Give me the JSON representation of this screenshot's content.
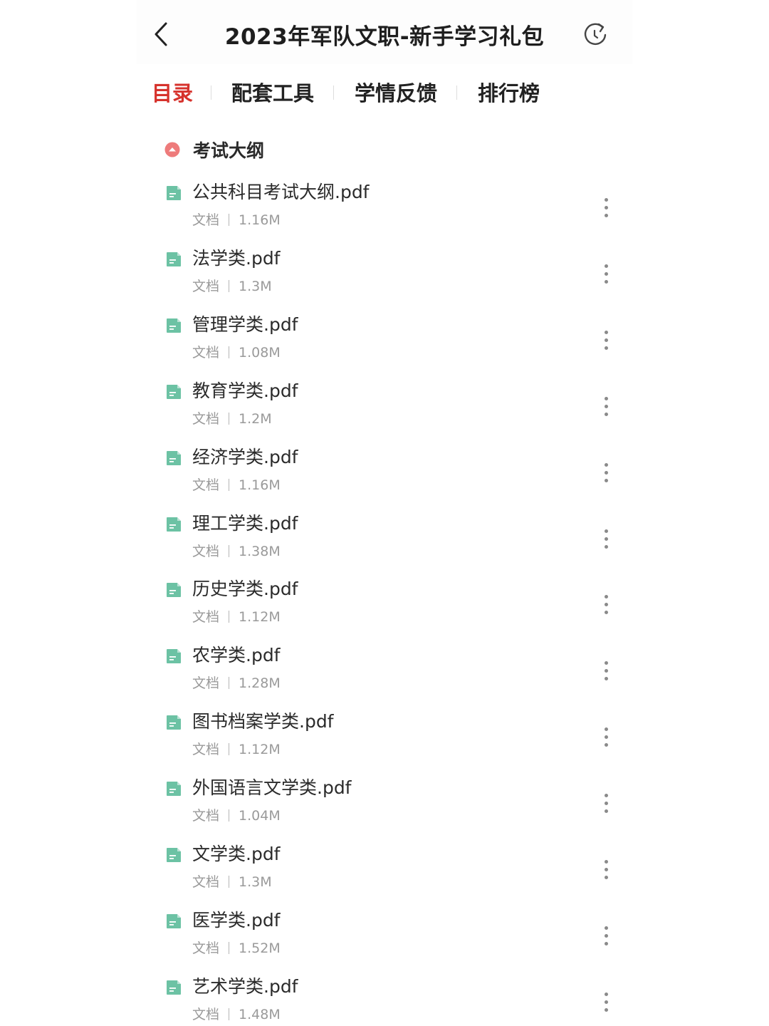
{
  "header": {
    "title": "2023年军队文职-新手学习礼包",
    "back_icon": "chevron-left-icon",
    "refresh_icon": "refresh-icon"
  },
  "tabs": [
    {
      "label": "目录",
      "active": true
    },
    {
      "label": "配套工具",
      "active": false
    },
    {
      "label": "学情反馈",
      "active": false
    },
    {
      "label": "排行榜",
      "active": false
    }
  ],
  "colors": {
    "active_tab": "#d6322c",
    "file_icon": "#6cc2a4",
    "section_toggle": "#ee7b7b",
    "meta_text": "#9a9a9a"
  },
  "section": {
    "title": "考试大纲",
    "expanded": true,
    "icon": "collapse-up-icon"
  },
  "files": [
    {
      "name": "公共科目考试大纲.pdf",
      "type": "文档",
      "size": "1.16M"
    },
    {
      "name": "法学类.pdf",
      "type": "文档",
      "size": "1.3M"
    },
    {
      "name": "管理学类.pdf",
      "type": "文档",
      "size": "1.08M"
    },
    {
      "name": "教育学类.pdf",
      "type": "文档",
      "size": "1.2M"
    },
    {
      "name": "经济学类.pdf",
      "type": "文档",
      "size": "1.16M"
    },
    {
      "name": "理工学类.pdf",
      "type": "文档",
      "size": "1.38M"
    },
    {
      "name": "历史学类.pdf",
      "type": "文档",
      "size": "1.12M"
    },
    {
      "name": "农学类.pdf",
      "type": "文档",
      "size": "1.28M"
    },
    {
      "name": "图书档案学类.pdf",
      "type": "文档",
      "size": "1.12M"
    },
    {
      "name": "外国语言文学类.pdf",
      "type": "文档",
      "size": "1.04M"
    },
    {
      "name": "文学类.pdf",
      "type": "文档",
      "size": "1.3M"
    },
    {
      "name": "医学类.pdf",
      "type": "文档",
      "size": "1.52M"
    },
    {
      "name": "艺术学类.pdf",
      "type": "文档",
      "size": "1.48M"
    }
  ]
}
